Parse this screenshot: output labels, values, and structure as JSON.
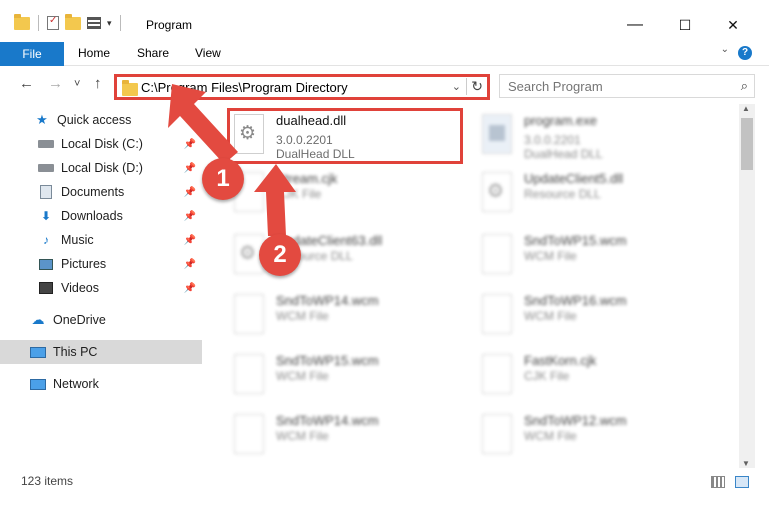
{
  "window": {
    "title": "Program",
    "buttons": {
      "minimize": "—",
      "maximize": "☐",
      "close": "✕"
    }
  },
  "ribbon": {
    "tabs": [
      "File",
      "Home",
      "Share",
      "View"
    ],
    "help": "?"
  },
  "navbar": {
    "back": "←",
    "forward": "→",
    "recent": "˅",
    "up": "↑",
    "address": "C:\\Program Files\\Program Directory",
    "search_placeholder": "Search Program"
  },
  "sidebar": {
    "items": [
      {
        "label": "Quick access",
        "icon": "star-icon"
      },
      {
        "label": "Local Disk (C:)",
        "icon": "disk-icon",
        "pinned": true
      },
      {
        "label": "Local Disk (D:)",
        "icon": "disk-icon",
        "pinned": true
      },
      {
        "label": "Documents",
        "icon": "documents-icon",
        "pinned": true
      },
      {
        "label": "Downloads",
        "icon": "download-icon",
        "pinned": true
      },
      {
        "label": "Music",
        "icon": "music-icon",
        "pinned": true
      },
      {
        "label": "Pictures",
        "icon": "pictures-icon",
        "pinned": true
      },
      {
        "label": "Videos",
        "icon": "videos-icon",
        "pinned": true
      },
      {
        "label": "OneDrive",
        "icon": "cloud-icon"
      },
      {
        "label": "This PC",
        "icon": "computer-icon",
        "selected": true
      },
      {
        "label": "Network",
        "icon": "network-icon"
      }
    ]
  },
  "files": [
    {
      "name": "dualhead.dll",
      "version": "3.0.0.2201",
      "type": "DualHead DLL",
      "icon": "dll-icon",
      "highlighted": true
    },
    {
      "name": "program.exe",
      "version": "3.0.0.2201",
      "type": "DualHead DLL",
      "icon": "exe-icon"
    },
    {
      "name": "Stream.cjk",
      "type": "CJK File",
      "icon": "file-icon"
    },
    {
      "name": "UpdateClient5.dll",
      "type": "Resource DLL",
      "icon": "dll-icon"
    },
    {
      "name": "UpdateClient63.dll",
      "type": "Resource DLL",
      "icon": "dll-icon"
    },
    {
      "name": "SndToWP15.wcm",
      "type": "WCM File",
      "icon": "file-icon"
    },
    {
      "name": "SndToWP14.wcm",
      "type": "WCM File",
      "icon": "file-icon"
    },
    {
      "name": "SndToWP16.wcm",
      "type": "WCM File",
      "icon": "file-icon"
    },
    {
      "name": "SndToWP15.wcm",
      "type": "WCM File",
      "icon": "file-icon"
    },
    {
      "name": "FastKorn.cjk",
      "type": "CJK File",
      "icon": "file-icon"
    },
    {
      "name": "SndToWP14.wcm",
      "type": "WCM File",
      "icon": "file-icon"
    },
    {
      "name": "SndToWP12.wcm",
      "type": "WCM File",
      "icon": "file-icon"
    }
  ],
  "status": {
    "count": "123 items"
  },
  "annotations": {
    "step1": "1",
    "step2": "2",
    "color": "#e34a40"
  }
}
